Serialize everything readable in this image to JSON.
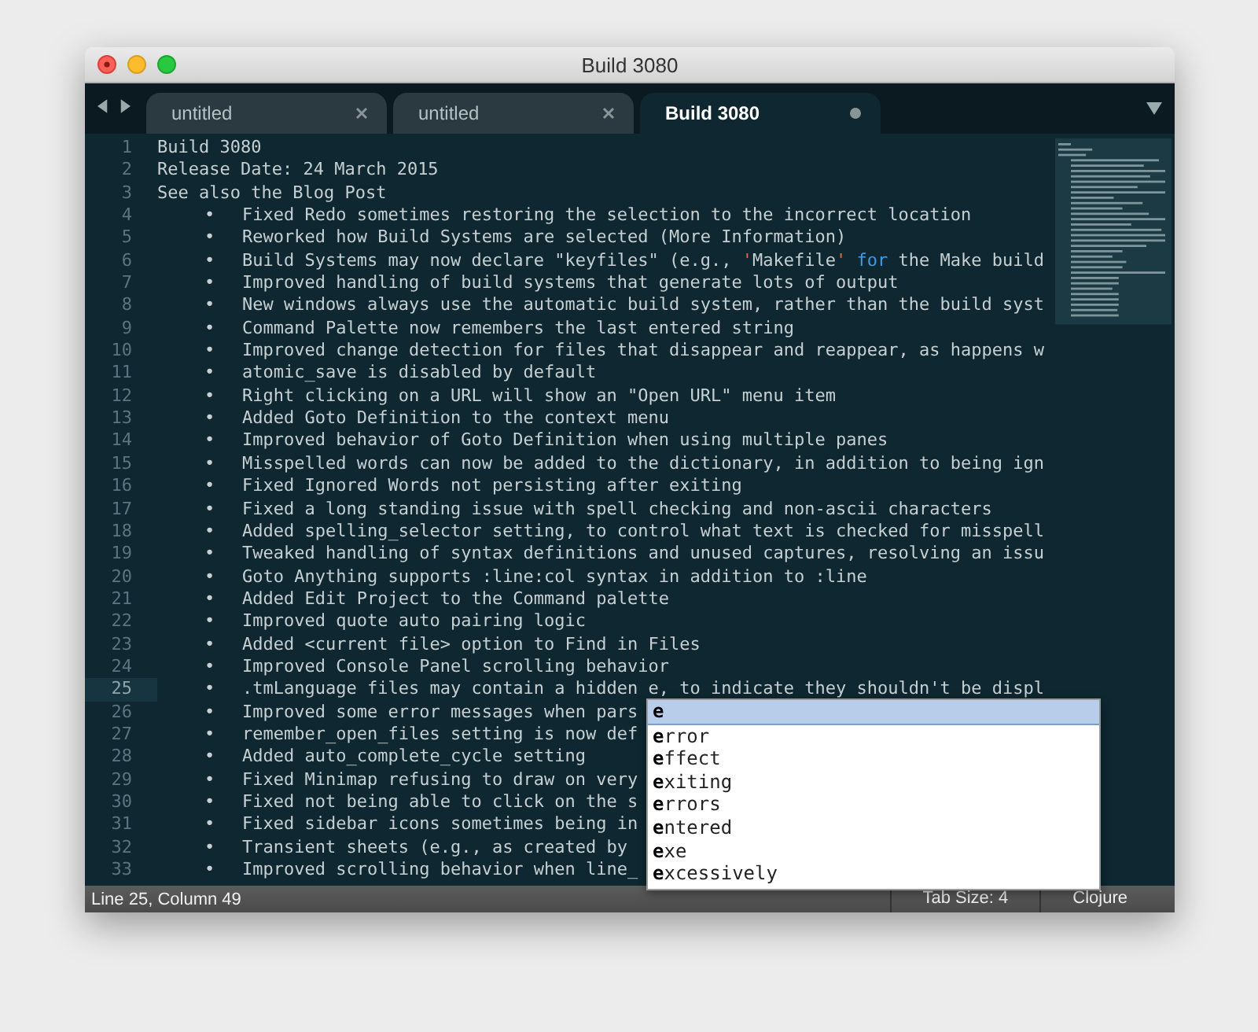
{
  "window": {
    "title": "Build 3080"
  },
  "tabs": [
    {
      "label": "untitled",
      "selected": false,
      "modified": false
    },
    {
      "label": "untitled",
      "selected": false,
      "modified": false
    },
    {
      "label": "Build 3080",
      "selected": true,
      "modified": true
    }
  ],
  "editor": {
    "lines": [
      {
        "number": "1",
        "text": "Build 3080",
        "current": false
      },
      {
        "number": "2",
        "text": "Release Date: 24 March 2015",
        "current": false
      },
      {
        "number": "3",
        "text": "See also the Blog Post",
        "current": false
      },
      {
        "number": "4",
        "bullet": "•",
        "text": "Fixed Redo sometimes restoring the selection to the incorrect location",
        "current": false
      },
      {
        "number": "5",
        "bullet": "•",
        "text": "Reworked how Build Systems are selected (More Information)",
        "current": false
      },
      {
        "number": "6",
        "bullet": "•",
        "segments": [
          {
            "text": "Build Systems may now declare \"keyfiles\" (e.g., ",
            "kind": "plain"
          },
          {
            "text": "'",
            "kind": "quote"
          },
          {
            "text": "Makefile",
            "kind": "plain"
          },
          {
            "text": "' ",
            "kind": "quote"
          },
          {
            "text": "for",
            "kind": "keyword"
          },
          {
            "text": " the Make build",
            "kind": "plain"
          }
        ],
        "current": false
      },
      {
        "number": "7",
        "bullet": "•",
        "text": "Improved handling of build systems that generate lots of output",
        "current": false
      },
      {
        "number": "8",
        "bullet": "•",
        "text": "New windows always use the automatic build system, rather than the build syst",
        "current": false
      },
      {
        "number": "9",
        "bullet": "•",
        "text": "Command Palette now remembers the last entered string",
        "current": false
      },
      {
        "number": "10",
        "bullet": "•",
        "text": "Improved change detection for files that disappear and reappear, as happens w",
        "current": false
      },
      {
        "number": "11",
        "bullet": "•",
        "text": "atomic_save is disabled by default",
        "current": false
      },
      {
        "number": "12",
        "bullet": "•",
        "text": "Right clicking on a URL will show an \"Open URL\" menu item",
        "current": false
      },
      {
        "number": "13",
        "bullet": "•",
        "text": "Added Goto Definition to the context menu",
        "current": false
      },
      {
        "number": "14",
        "bullet": "•",
        "text": "Improved behavior of Goto Definition when using multiple panes",
        "current": false
      },
      {
        "number": "15",
        "bullet": "•",
        "text": "Misspelled words can now be added to the dictionary, in addition to being ign",
        "current": false
      },
      {
        "number": "16",
        "bullet": "•",
        "text": "Fixed Ignored Words not persisting after exiting",
        "current": false
      },
      {
        "number": "17",
        "bullet": "•",
        "text": "Fixed a long standing issue with spell checking and non-ascii characters",
        "current": false
      },
      {
        "number": "18",
        "bullet": "•",
        "text": "Added spelling_selector setting, to control what text is checked for misspell",
        "current": false
      },
      {
        "number": "19",
        "bullet": "•",
        "text": "Tweaked handling of syntax definitions and unused captures, resolving an issu",
        "current": false
      },
      {
        "number": "20",
        "bullet": "•",
        "text": "Goto Anything supports :line:col syntax in addition to :line",
        "current": false
      },
      {
        "number": "21",
        "bullet": "•",
        "text": "Added Edit Project to the Command palette",
        "current": false
      },
      {
        "number": "22",
        "bullet": "•",
        "text": "Improved quote auto pairing logic",
        "current": false
      },
      {
        "number": "23",
        "bullet": "•",
        "text": "Added <current file> option to Find in Files",
        "current": false
      },
      {
        "number": "24",
        "bullet": "•",
        "text": "Improved Console Panel scrolling behavior",
        "current": false
      },
      {
        "number": "25",
        "bullet": "•",
        "text": ".tmLanguage files may contain a hidden e, to indicate they shouldn't be displ",
        "current": true
      },
      {
        "number": "26",
        "bullet": "•",
        "text": "Improved some error messages when pars",
        "current": false
      },
      {
        "number": "27",
        "bullet": "•",
        "text": "remember_open_files setting is now def",
        "current": false
      },
      {
        "number": "28",
        "bullet": "•",
        "text": "Added auto_complete_cycle setting",
        "current": false
      },
      {
        "number": "29",
        "bullet": "•",
        "text": "Fixed Minimap refusing to draw on very",
        "current": false
      },
      {
        "number": "30",
        "bullet": "•",
        "text": "Fixed not being able to click on the s",
        "current": false
      },
      {
        "number": "31",
        "bullet": "•",
        "text": "Fixed sidebar icons sometimes being in",
        "current": false
      },
      {
        "number": "32",
        "bullet": "•",
        "text": "Transient sheets (e.g., as created by",
        "current": false
      },
      {
        "number": "33",
        "bullet": "•",
        "text": "Improved scrolling behavior when line_",
        "current": false
      }
    ]
  },
  "autocomplete": {
    "items": [
      {
        "label": "**e**",
        "selected": true
      },
      {
        "label": "**e**rror",
        "selected": false
      },
      {
        "label": "**e**ffect",
        "selected": false
      },
      {
        "label": "**e**xiting",
        "selected": false
      },
      {
        "label": "**e**rrors",
        "selected": false
      },
      {
        "label": "**e**ntered",
        "selected": false
      },
      {
        "label": "**e**xe",
        "selected": false
      },
      {
        "label": "**e**xcessively",
        "selected": false
      }
    ]
  },
  "status_bar": {
    "position": "Line 25, Column 49",
    "tab_size": "Tab Size: 4",
    "syntax": "Clojure"
  }
}
